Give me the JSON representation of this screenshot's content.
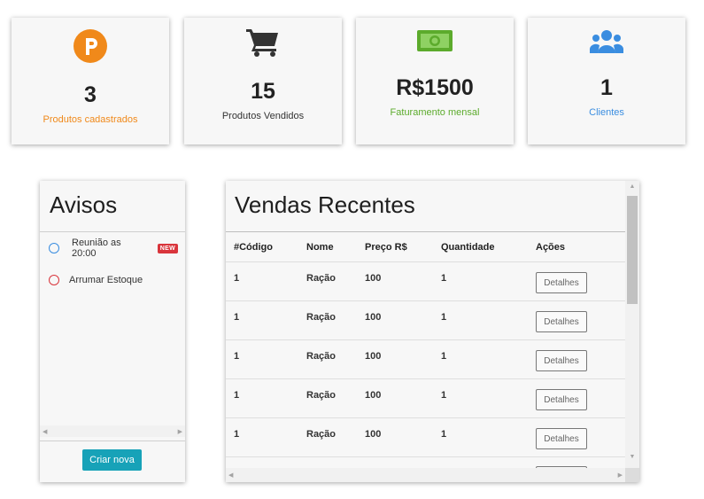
{
  "stats": [
    {
      "value": "3",
      "label": "Produtos cadastrados",
      "icon": "parking-coin-icon",
      "color": "#f0891a"
    },
    {
      "value": "15",
      "label": "Produtos Vendidos",
      "icon": "cart-icon",
      "color": "#333333"
    },
    {
      "value": "R$1500",
      "label": "Faturamento mensal",
      "icon": "money-bill-icon",
      "color": "#5cab2c"
    },
    {
      "value": "1",
      "label": "Clientes",
      "icon": "users-icon",
      "color": "#3a8de0"
    }
  ],
  "avisos": {
    "title": "Avisos",
    "items": [
      {
        "text": "Reunião as 20:00",
        "badge": "NEW",
        "color": "#3a8de0"
      },
      {
        "text": "Arrumar Estoque",
        "badge": "",
        "color": "#d9353c"
      }
    ],
    "new_button": "Criar nova"
  },
  "vendas": {
    "title": "Vendas Recentes",
    "headers": [
      "#Código",
      "Nome",
      "Preço R$",
      "Quantidade",
      "Ações"
    ],
    "rows": [
      {
        "codigo": "1",
        "nome": "Ração",
        "preco": "100",
        "quantidade": "1",
        "acao": "Detalhes"
      },
      {
        "codigo": "1",
        "nome": "Ração",
        "preco": "100",
        "quantidade": "1",
        "acao": "Detalhes"
      },
      {
        "codigo": "1",
        "nome": "Ração",
        "preco": "100",
        "quantidade": "1",
        "acao": "Detalhes"
      },
      {
        "codigo": "1",
        "nome": "Ração",
        "preco": "100",
        "quantidade": "1",
        "acao": "Detalhes"
      },
      {
        "codigo": "1",
        "nome": "Ração",
        "preco": "100",
        "quantidade": "1",
        "acao": "Detalhes"
      }
    ]
  }
}
